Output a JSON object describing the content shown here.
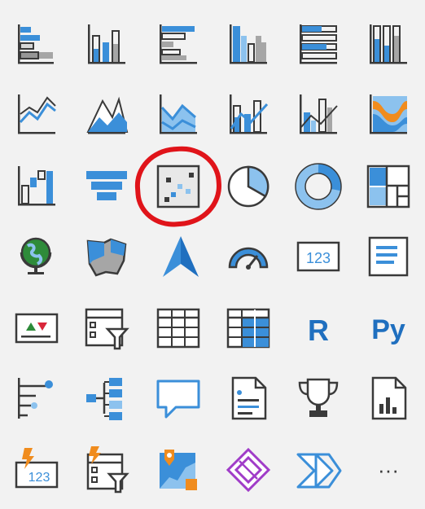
{
  "panel": {
    "colors": {
      "blue": "#3b8fd9",
      "light_blue": "#8cc2ee",
      "dark": "#3a3a3a",
      "gray": "#a6a6a6",
      "light_gray": "#d0d0d0",
      "green": "#2e8b3a",
      "red": "#d9263a",
      "orange": "#f08c1e",
      "purple": "#a03cc8",
      "highlight": "#e0141a"
    },
    "highlighted_item": "scatter-chart-icon",
    "items": [
      {
        "row": 0,
        "icon": "stacked-bar-chart-icon"
      },
      {
        "row": 0,
        "icon": "stacked-column-chart-icon"
      },
      {
        "row": 0,
        "icon": "clustered-bar-chart-icon"
      },
      {
        "row": 0,
        "icon": "clustered-column-chart-icon"
      },
      {
        "row": 0,
        "icon": "100-percent-stacked-bar-chart-icon"
      },
      {
        "row": 0,
        "icon": "100-percent-stacked-column-chart-icon"
      },
      {
        "row": 1,
        "icon": "line-chart-icon"
      },
      {
        "row": 1,
        "icon": "area-chart-icon"
      },
      {
        "row": 1,
        "icon": "stacked-area-chart-icon"
      },
      {
        "row": 1,
        "icon": "line-and-stacked-column-chart-icon"
      },
      {
        "row": 1,
        "icon": "line-and-clustered-column-chart-icon"
      },
      {
        "row": 1,
        "icon": "ribbon-chart-icon"
      },
      {
        "row": 2,
        "icon": "waterfall-chart-icon"
      },
      {
        "row": 2,
        "icon": "funnel-chart-icon"
      },
      {
        "row": 2,
        "icon": "scatter-chart-icon"
      },
      {
        "row": 2,
        "icon": "pie-chart-icon"
      },
      {
        "row": 2,
        "icon": "donut-chart-icon"
      },
      {
        "row": 2,
        "icon": "treemap-icon"
      },
      {
        "row": 3,
        "icon": "map-icon"
      },
      {
        "row": 3,
        "icon": "filled-map-icon"
      },
      {
        "row": 3,
        "icon": "azure-map-icon"
      },
      {
        "row": 3,
        "icon": "gauge-icon"
      },
      {
        "row": 3,
        "icon": "card-icon",
        "text": "123"
      },
      {
        "row": 3,
        "icon": "multi-row-card-icon"
      },
      {
        "row": 4,
        "icon": "kpi-icon"
      },
      {
        "row": 4,
        "icon": "slicer-icon"
      },
      {
        "row": 4,
        "icon": "table-icon"
      },
      {
        "row": 4,
        "icon": "matrix-icon"
      },
      {
        "row": 4,
        "icon": "r-script-visual-icon",
        "text": "R"
      },
      {
        "row": 4,
        "icon": "python-visual-icon",
        "text": "Py"
      },
      {
        "row": 5,
        "icon": "key-influencers-icon"
      },
      {
        "row": 5,
        "icon": "decomposition-tree-icon"
      },
      {
        "row": 5,
        "icon": "qa-icon"
      },
      {
        "row": 5,
        "icon": "smart-narrative-icon"
      },
      {
        "row": 5,
        "icon": "goals-trophy-icon"
      },
      {
        "row": 5,
        "icon": "paginated-report-icon"
      },
      {
        "row": 6,
        "icon": "power-card-icon",
        "text": "123"
      },
      {
        "row": 6,
        "icon": "power-slicer-icon"
      },
      {
        "row": 6,
        "icon": "azure-map-visual-icon"
      },
      {
        "row": 6,
        "icon": "power-apps-icon"
      },
      {
        "row": 6,
        "icon": "power-automate-icon"
      },
      {
        "row": 6,
        "icon": "more-visuals-icon",
        "text": "···"
      }
    ]
  }
}
